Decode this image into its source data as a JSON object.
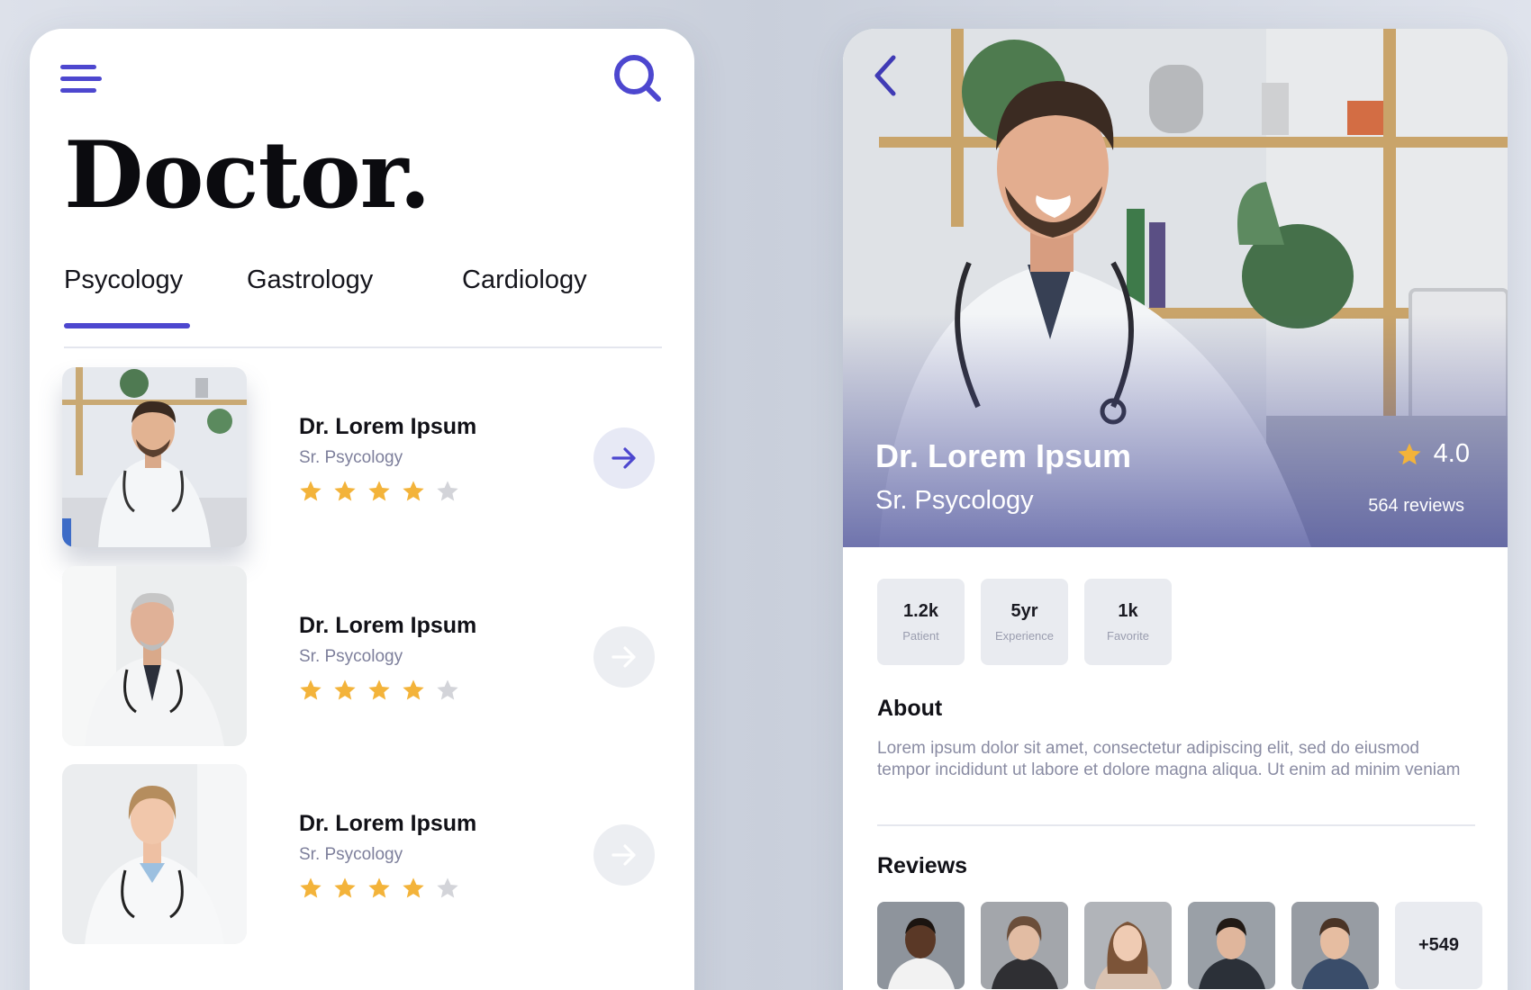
{
  "colors": {
    "accent": "#4d47cf",
    "star_filled": "#f3b33a",
    "star_empty": "#d3d4d9",
    "background": "#d5d9e3"
  },
  "list_screen": {
    "title": "Doctor.",
    "icons": {
      "menu": "hamburger-menu-icon",
      "search": "search-icon"
    },
    "tabs": [
      {
        "label": "Psycology",
        "active": true
      },
      {
        "label": "Gastrology",
        "active": false
      },
      {
        "label": "Cardiology",
        "active": false
      }
    ],
    "doctors": [
      {
        "name": "Dr. Lorem Ipsum",
        "specialty": "Sr. Psycology",
        "rating": 4,
        "max_rating": 5,
        "highlighted": true
      },
      {
        "name": "Dr. Lorem Ipsum",
        "specialty": "Sr. Psycology",
        "rating": 4,
        "max_rating": 5,
        "highlighted": false
      },
      {
        "name": "Dr. Lorem Ipsum",
        "specialty": "Sr. Psycology",
        "rating": 4,
        "max_rating": 5,
        "highlighted": false
      }
    ]
  },
  "detail_screen": {
    "name": "Dr. Lorem Ipsum",
    "specialty": "Sr. Psycology",
    "rating": "4.0",
    "reviews_count": "564 reviews",
    "stats": [
      {
        "value": "1.2k",
        "label": "Patient"
      },
      {
        "value": "5yr",
        "label": "Experience"
      },
      {
        "value": "1k",
        "label": "Favorite"
      }
    ],
    "about": {
      "title": "About",
      "text": "Lorem ipsum dolor sit amet, consectetur adipiscing elit, sed do eiusmod tempor incididunt ut labore et dolore magna aliqua. Ut enim ad minim veniam"
    },
    "reviews": {
      "title": "Reviews",
      "more": "+549"
    }
  }
}
